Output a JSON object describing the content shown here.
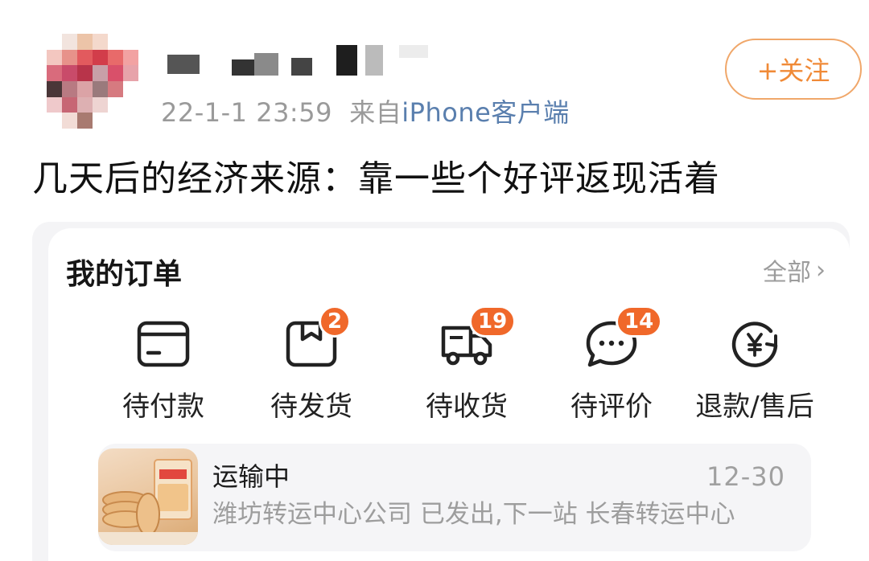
{
  "post": {
    "timestamp": "22-1-1 23:59",
    "source_prefix": "来自",
    "source_client": "iPhone客户端",
    "follow_label": "+关注",
    "text": "几天后的经济来源：靠一些个好评返现活着"
  },
  "orders": {
    "title": "我的订单",
    "all_label": "全部",
    "categories": [
      {
        "label": "待付款",
        "icon": "wallet-card-icon",
        "badge": ""
      },
      {
        "label": "待发货",
        "icon": "package-box-icon",
        "badge": "2"
      },
      {
        "label": "待收货",
        "icon": "delivery-truck-icon",
        "badge": "19"
      },
      {
        "label": "待评价",
        "icon": "chat-bubble-icon",
        "badge": "14"
      },
      {
        "label": "退款/售后",
        "icon": "yuan-refund-icon",
        "badge": ""
      }
    ],
    "shipment": {
      "status": "运输中",
      "date": "12-30",
      "detail": "潍坊转运中心公司 已发出,下一站 长春转运中心"
    }
  },
  "colors": {
    "accent_orange": "#f08a37",
    "badge_orange": "#f0682a",
    "link_blue": "#5a7fae"
  }
}
